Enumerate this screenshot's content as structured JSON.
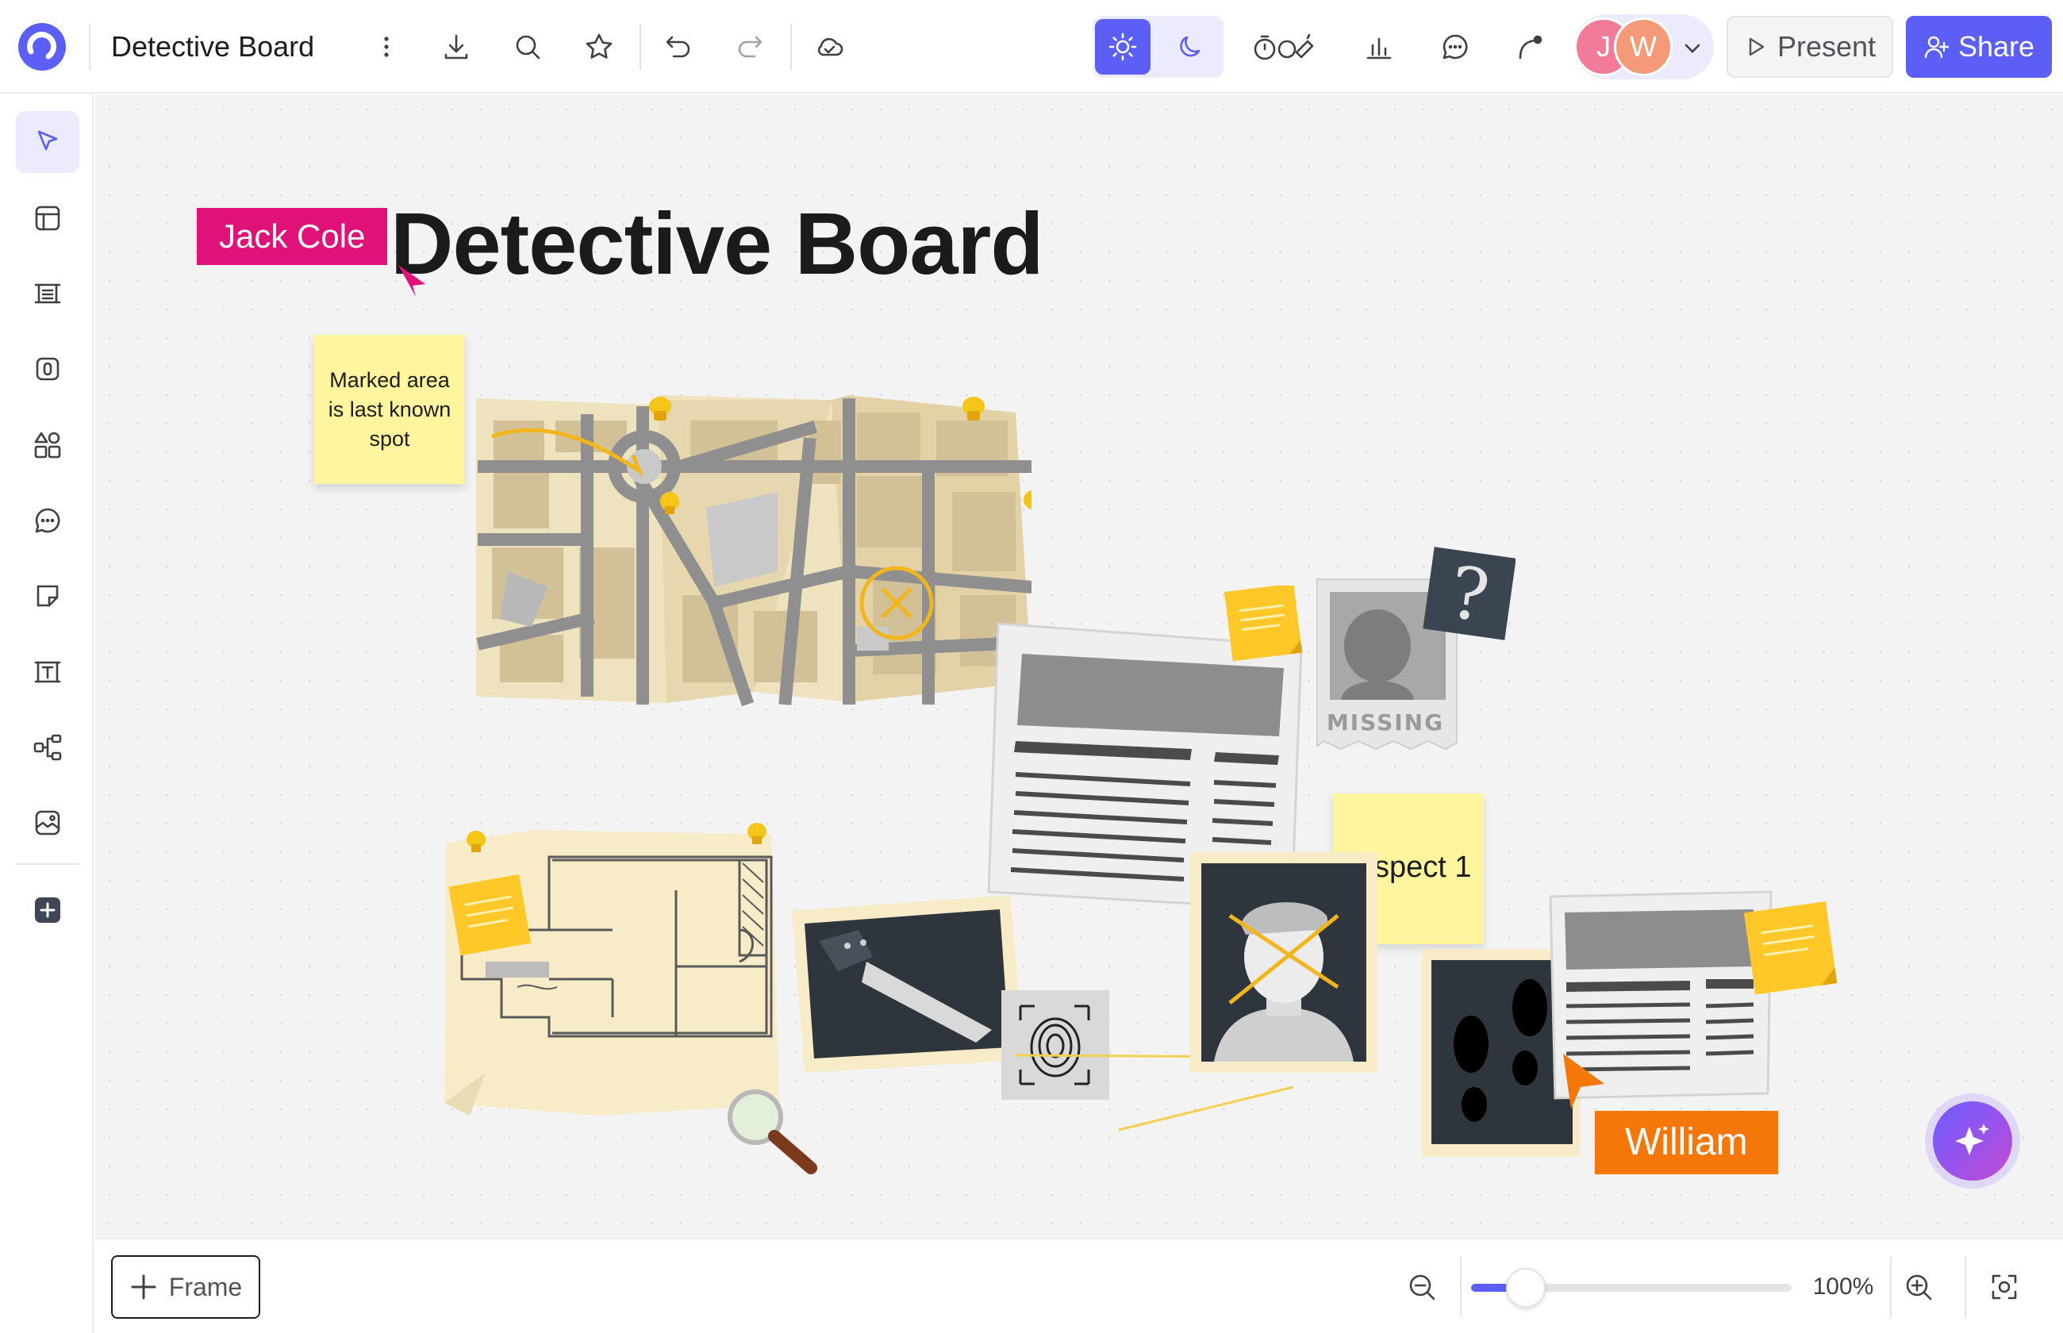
{
  "app": {
    "title": "Detective Board",
    "brand_color": "#5b5ff5"
  },
  "toolbar": {
    "icons": [
      "more-icon",
      "download-icon",
      "search-icon",
      "star-icon",
      "undo-icon",
      "redo-icon",
      "cloud-icon"
    ],
    "theme": {
      "light_icon": "sun-icon",
      "dark_icon": "moon-icon",
      "active": "light"
    },
    "tools": [
      "timer-icon",
      "chart-icon",
      "comment-icon",
      "connector-icon"
    ],
    "avatars": [
      {
        "initial": "J",
        "color": "#f27a9a"
      },
      {
        "initial": "W",
        "color": "#f59a78"
      }
    ],
    "present_label": "Present",
    "share_label": "Share"
  },
  "sidebar": {
    "items": [
      "select-tool",
      "template-tool",
      "frame-tool",
      "sticker-tool",
      "shapes-tool",
      "comment-tool",
      "sticky-note-tool",
      "text-tool",
      "mindmap-tool",
      "media-tool",
      "add-tool"
    ],
    "active": "select-tool"
  },
  "board": {
    "title": "Detective Board",
    "sticky_note": "Marked area is last known spot",
    "suspect_note": "spect 1",
    "missing_label": "MISSING",
    "question_mark": "?",
    "cursors": [
      {
        "name": "Jack Cole",
        "color": "#e0127a"
      },
      {
        "name": "William",
        "color": "#f5770a"
      }
    ]
  },
  "bottom": {
    "frame_label": "Frame",
    "zoom": "100%",
    "zoom_fraction": 0.17
  }
}
